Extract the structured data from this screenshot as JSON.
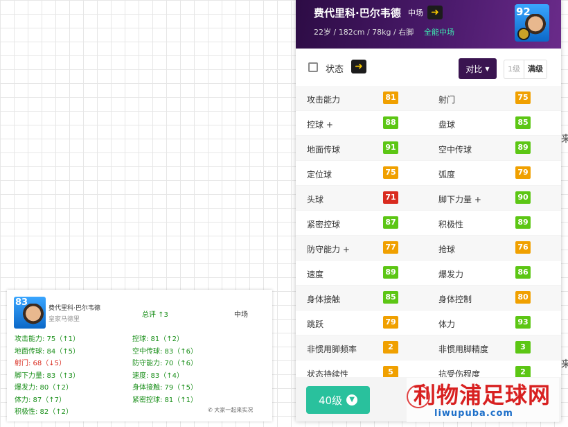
{
  "header": {
    "name": "费代里科·巴尔韦德",
    "position": "中场",
    "bio": "22岁 / 182cm / 78kg / 右脚",
    "role": "全能中场",
    "rating": "92"
  },
  "state_bar": {
    "label": "状态",
    "compare": "对比",
    "level_1": "1级",
    "level_max": "满级"
  },
  "stats": [
    [
      {
        "label": "攻击能力",
        "value": "81",
        "color": "orange"
      },
      {
        "label": "射门",
        "value": "75",
        "color": "orange"
      }
    ],
    [
      {
        "label": "控球 +",
        "value": "88",
        "color": "green"
      },
      {
        "label": "盘球",
        "value": "85",
        "color": "green"
      }
    ],
    [
      {
        "label": "地面传球",
        "value": "91",
        "color": "green"
      },
      {
        "label": "空中传球",
        "value": "89",
        "color": "green"
      }
    ],
    [
      {
        "label": "定位球",
        "value": "75",
        "color": "orange"
      },
      {
        "label": "弧度",
        "value": "79",
        "color": "orange"
      }
    ],
    [
      {
        "label": "头球",
        "value": "71",
        "color": "red"
      },
      {
        "label": "脚下力量 +",
        "value": "90",
        "color": "green"
      }
    ],
    [
      {
        "label": "紧密控球",
        "value": "87",
        "color": "green"
      },
      {
        "label": "积极性",
        "value": "89",
        "color": "green"
      }
    ],
    [
      {
        "label": "防守能力 +",
        "value": "77",
        "color": "orange"
      },
      {
        "label": "抢球",
        "value": "76",
        "color": "orange"
      }
    ],
    [
      {
        "label": "速度",
        "value": "89",
        "color": "green"
      },
      {
        "label": "爆发力",
        "value": "86",
        "color": "green"
      }
    ],
    [
      {
        "label": "身体接触",
        "value": "85",
        "color": "green"
      },
      {
        "label": "身体控制",
        "value": "80",
        "color": "orange"
      }
    ],
    [
      {
        "label": "跳跃",
        "value": "79",
        "color": "orange"
      },
      {
        "label": "体力",
        "value": "93",
        "color": "green"
      }
    ],
    [
      {
        "label": "非惯用脚频率",
        "value": "2",
        "color": "orange"
      },
      {
        "label": "非惯用脚精度",
        "value": "3",
        "color": "green"
      }
    ],
    [
      {
        "label": "状态持续性",
        "value": "5",
        "color": "orange"
      },
      {
        "label": "抗受伤程度",
        "value": "2",
        "color": "green"
      }
    ]
  ],
  "footer": {
    "level_button": "40级"
  },
  "mini_card": {
    "rating": "83",
    "name": "费代里科·巴尔韦德",
    "club": "皇家马德里",
    "overall": "总评 ↑3",
    "position": "中场",
    "wechat": "大家一起来实况",
    "left_stats": [
      {
        "text": "攻击能力: 75（↑1）",
        "down": false
      },
      {
        "text": "地面传球: 84（↑5）",
        "down": false
      },
      {
        "text": "射门: 68（↓5）",
        "down": true
      },
      {
        "text": "脚下力量: 83（↑3）",
        "down": false
      },
      {
        "text": "爆发力: 80（↑2）",
        "down": false
      },
      {
        "text": "体力: 87（↑7）",
        "down": false
      },
      {
        "text": "积极性: 82（↑2）",
        "down": false
      }
    ],
    "right_stats": [
      {
        "text": "控球: 81（↑2）",
        "down": false
      },
      {
        "text": "空中传球: 83（↑6）",
        "down": false
      },
      {
        "text": "防守能力: 70（↑6）",
        "down": false
      },
      {
        "text": "速度: 83（↑4）",
        "down": false
      },
      {
        "text": "身体接触: 79（↑5）",
        "down": false
      },
      {
        "text": "紧密控球: 81（↑1）",
        "down": false
      }
    ]
  },
  "watermark": {
    "title": "利物浦足球网",
    "url": "liwupuba.com"
  },
  "colors": {
    "green": "#5cc614",
    "orange": "#f0a000",
    "red": "#d92b1f",
    "header_purple": "#3a1450",
    "level_button": "#29c19d"
  }
}
